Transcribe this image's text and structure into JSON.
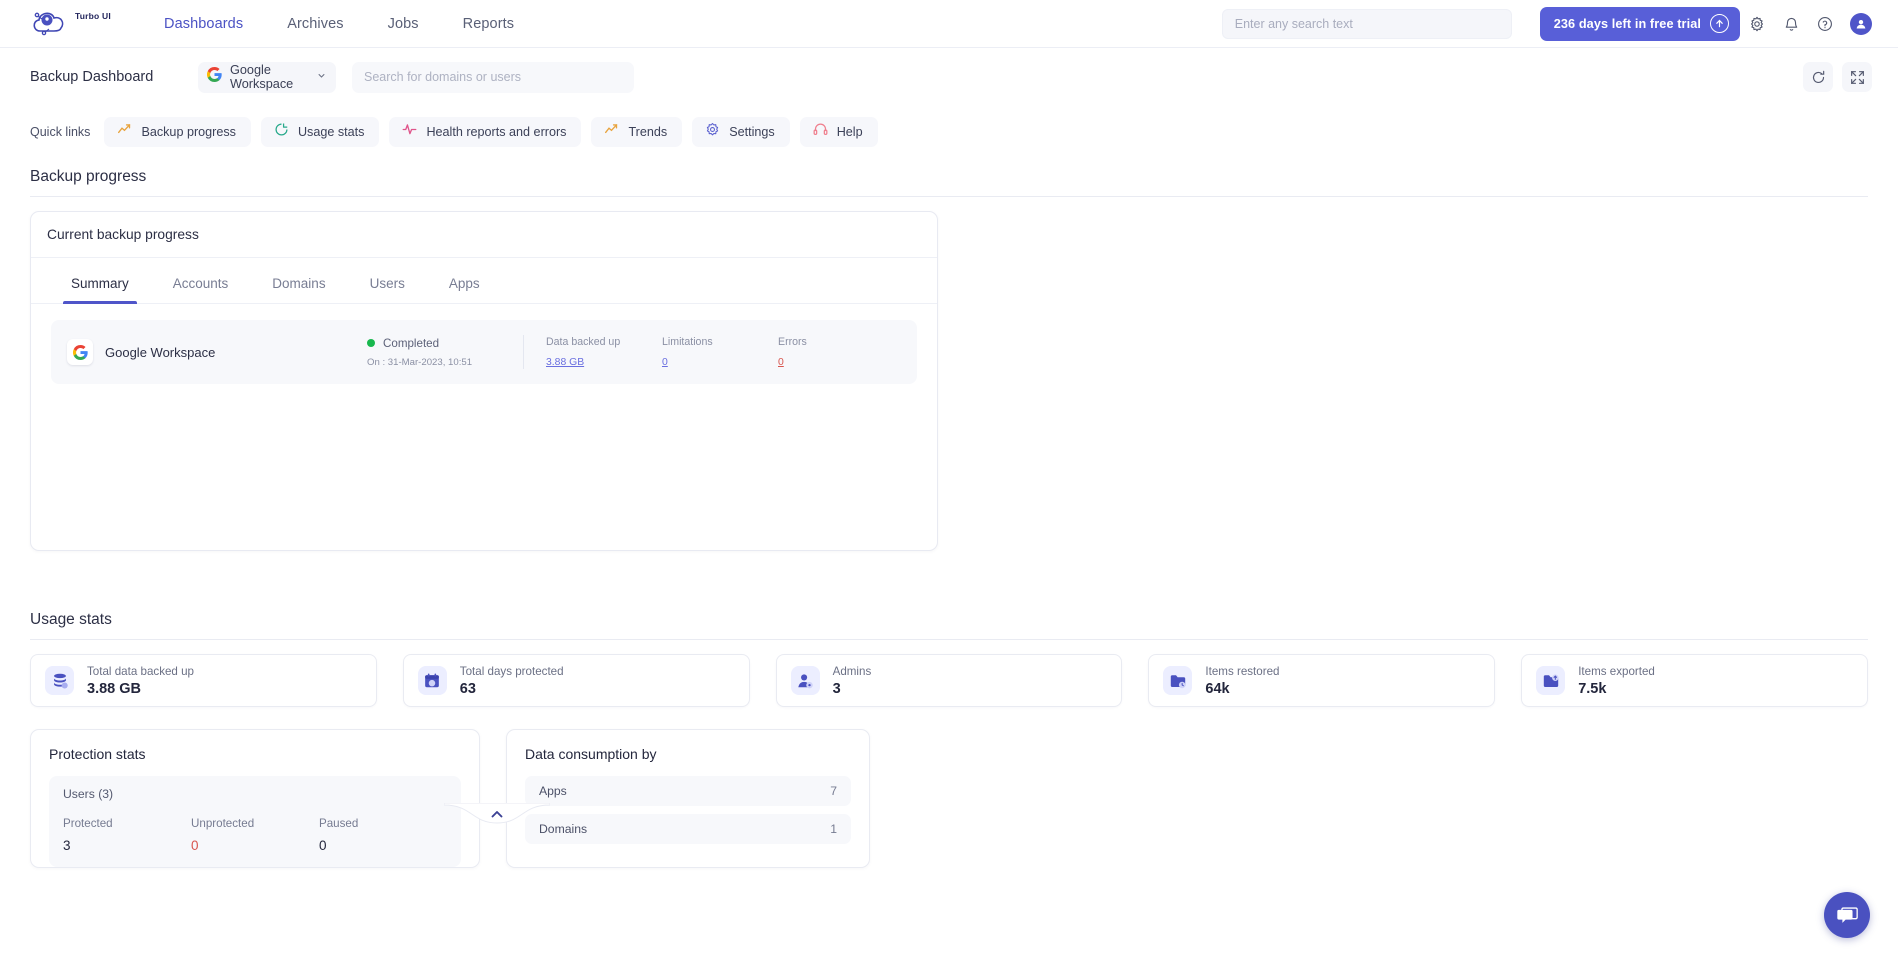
{
  "nav": {
    "brand_name": "Turbo UI",
    "links": [
      {
        "label": "Dashboards",
        "active": true
      },
      {
        "label": "Archives",
        "active": false
      },
      {
        "label": "Jobs",
        "active": false
      },
      {
        "label": "Reports",
        "active": false
      }
    ],
    "search_placeholder": "Enter any search text",
    "search_value": "",
    "trial_label": "236 days left in free trial",
    "icons": [
      "gear-icon",
      "bell-icon",
      "help-icon",
      "avatar"
    ],
    "accent_color": "#585fd8"
  },
  "subheader": {
    "page_title": "Backup Dashboard",
    "workspace_label": "Google Workspace",
    "domain_search_placeholder": "Search for domains or users",
    "domain_search_value": "",
    "refresh_tooltip": "Refresh",
    "expand_tooltip": "Expand"
  },
  "quick_links": {
    "label": "Quick links",
    "items": [
      {
        "label": "Backup progress",
        "icon": "trending-up-icon",
        "color": "#e8a33d"
      },
      {
        "label": "Usage stats",
        "icon": "pie-chart-icon",
        "color": "#27a98b"
      },
      {
        "label": "Health reports and errors",
        "icon": "activity-pulse-icon",
        "color": "#e0548a"
      },
      {
        "label": "Trends",
        "icon": "trending-up-icon",
        "color": "#e8a33d"
      },
      {
        "label": "Settings",
        "icon": "gear-icon",
        "color": "#5a60cf"
      },
      {
        "label": "Help",
        "icon": "headset-icon",
        "color": "#ef7f8e"
      }
    ]
  },
  "backup_progress": {
    "section_title": "Backup progress",
    "card_title": "Current backup progress",
    "tabs": [
      {
        "label": "Summary",
        "active": true
      },
      {
        "label": "Accounts",
        "active": false
      },
      {
        "label": "Domains",
        "active": false
      },
      {
        "label": "Users",
        "active": false
      },
      {
        "label": "Apps",
        "active": false
      }
    ],
    "row": {
      "app_name": "Google Workspace",
      "status": "Completed",
      "status_color": "#18b84e",
      "status_sub": "On : 31-Mar-2023, 10:51",
      "metrics": [
        {
          "label": "Data backed up",
          "value": "3.88 GB",
          "error": false
        },
        {
          "label": "Limitations",
          "value": "0",
          "error": false
        },
        {
          "label": "Errors",
          "value": "0",
          "error": true
        }
      ]
    }
  },
  "usage_stats": {
    "section_title": "Usage stats",
    "cards": [
      {
        "label": "Total data backed up",
        "value": "3.88 GB",
        "icon": "database-icon"
      },
      {
        "label": "Total days protected",
        "value": "63",
        "icon": "calendar-icon"
      },
      {
        "label": "Admins",
        "value": "3",
        "icon": "user-gear-icon"
      },
      {
        "label": "Items restored",
        "value": "64k",
        "icon": "folder-restore-icon"
      },
      {
        "label": "Items exported",
        "value": "7.5k",
        "icon": "folder-export-icon"
      }
    ]
  },
  "protection_stats": {
    "title": "Protection stats",
    "group_label": "Users (3)",
    "columns": [
      {
        "head": "Protected",
        "value": "3",
        "error": false
      },
      {
        "head": "Unprotected",
        "value": "0",
        "error": true
      },
      {
        "head": "Paused",
        "value": "0",
        "error": false
      }
    ]
  },
  "data_consumption": {
    "title": "Data consumption by",
    "rows": [
      {
        "name": "Apps",
        "count": "7"
      },
      {
        "name": "Domains",
        "count": "1"
      }
    ]
  },
  "chat": {
    "icon": "chat-bubble-icon"
  }
}
